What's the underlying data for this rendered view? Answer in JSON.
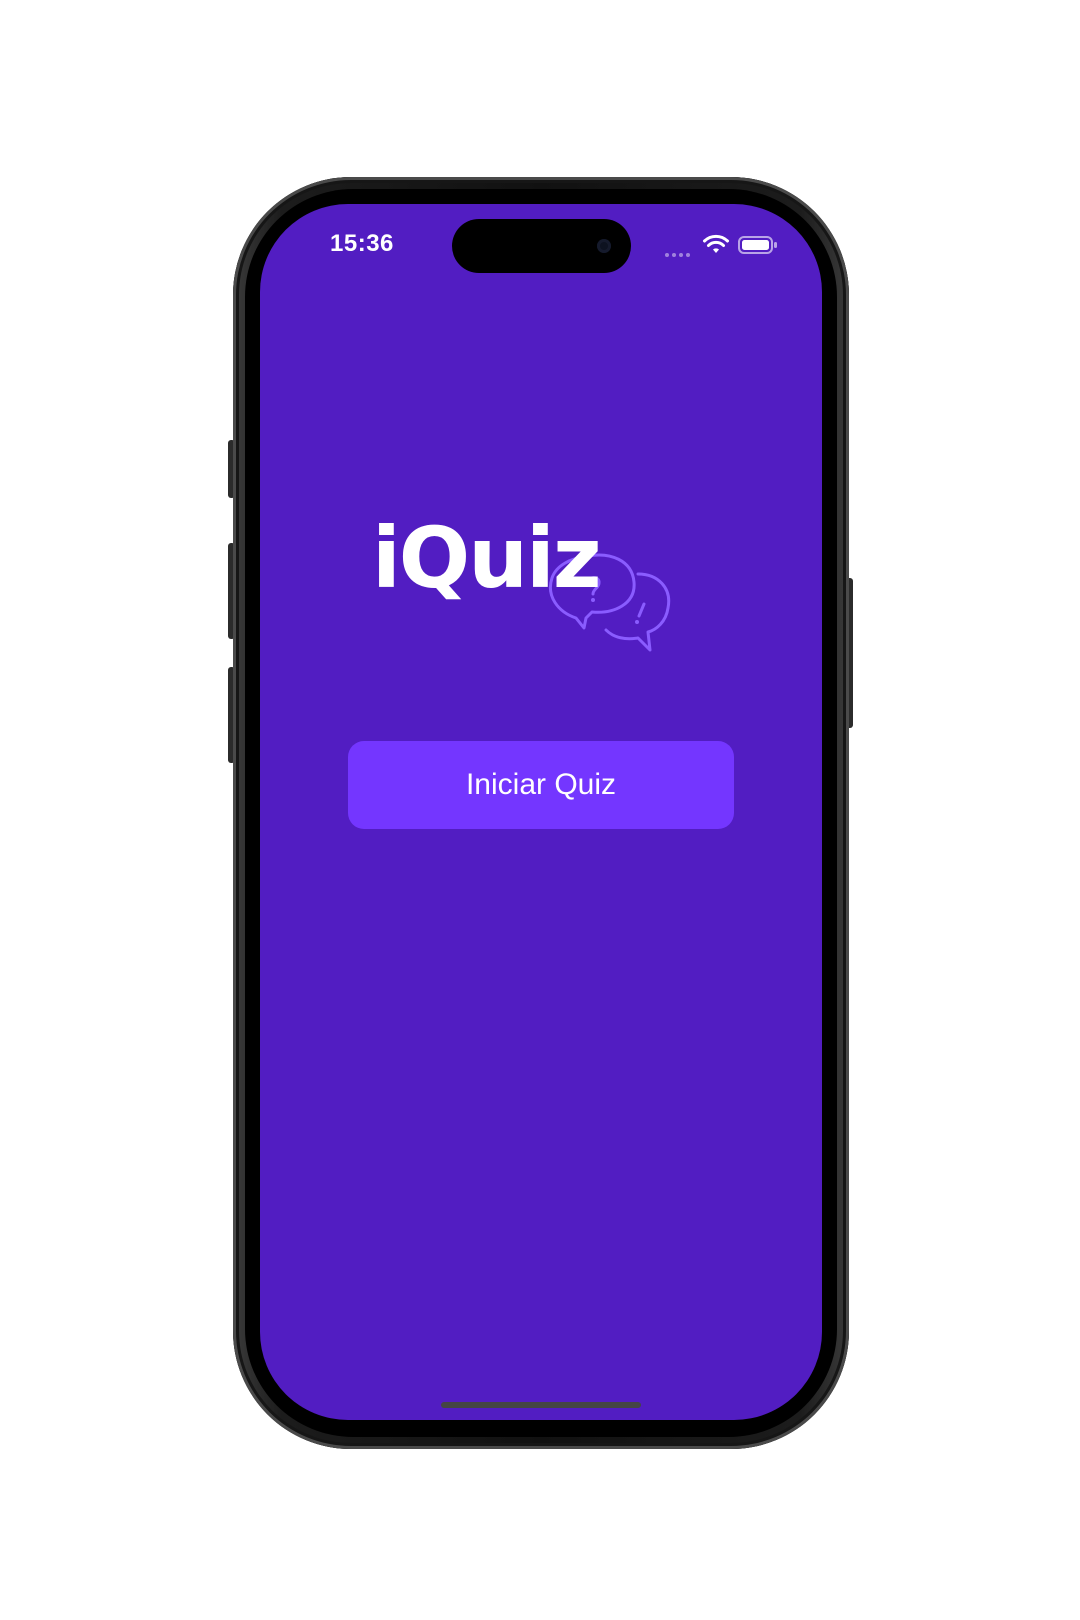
{
  "status_bar": {
    "time": "15:36"
  },
  "app": {
    "logo_text": "iQuiz",
    "logo_icon": "chat-bubbles-question-exclamation-icon",
    "start_button_label": "Iniciar Quiz"
  },
  "colors": {
    "screen_background": "#521dc2",
    "button_background": "#7436ff",
    "text": "#ffffff",
    "logo_icon_stroke": "#8a5cff"
  }
}
